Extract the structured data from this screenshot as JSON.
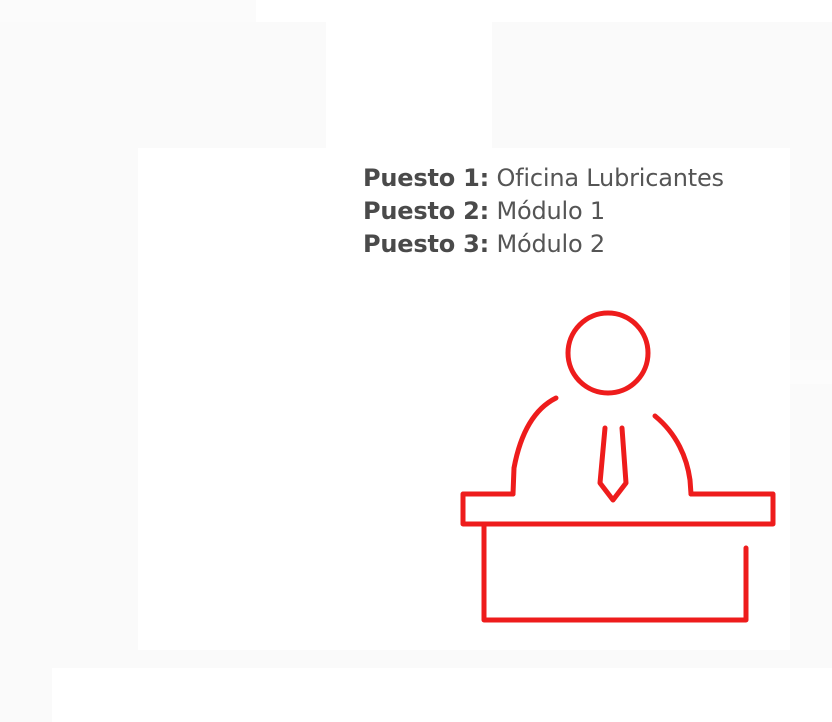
{
  "positions": [
    {
      "label": "Puesto 1",
      "separator": ":",
      "value": " Oficina Lubricantes"
    },
    {
      "label": "Puesto 2",
      "separator": ":",
      "value": " Módulo 1"
    },
    {
      "label": "Puesto 3",
      "separator": ":",
      "value": " Módulo 2"
    }
  ],
  "icon": {
    "name": "person-at-desk-icon",
    "color": "#ee1c1c"
  },
  "colors": {
    "background": "#fafafa",
    "card": "#ffffff",
    "text": "#555555"
  }
}
